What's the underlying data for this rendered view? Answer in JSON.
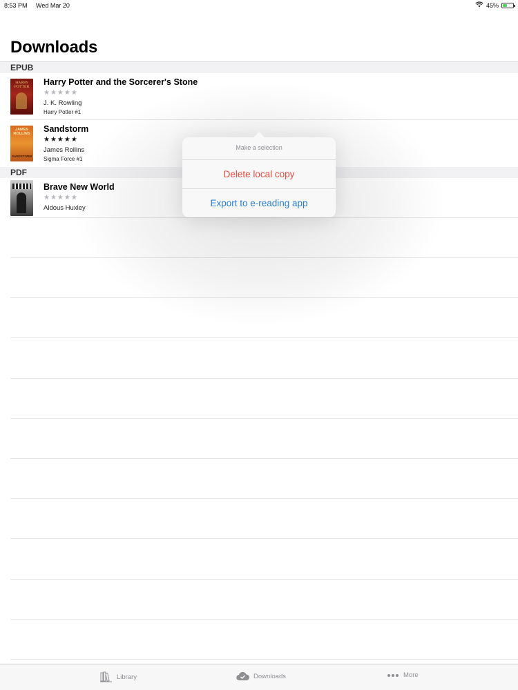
{
  "status_bar": {
    "time": "8:53 PM",
    "date": "Wed Mar 20",
    "battery": "45%",
    "battery_level": 0.45
  },
  "page": {
    "title": "Downloads"
  },
  "sections": [
    {
      "label": "EPUB",
      "items": [
        {
          "title": "Harry Potter and the Sorcerer's Stone",
          "stars": "★★★★★",
          "rated": false,
          "author": "J. K. Rowling",
          "series": "Harry Potter #1",
          "cover_text": "HARRY POTTER"
        },
        {
          "title": "Sandstorm",
          "stars": "★★★★★",
          "rated": true,
          "author": "James Rollins",
          "series": "Sigma Force #1",
          "cover_text": "JAMES ROLLINS",
          "cover_text2": "SANDSTORM"
        }
      ]
    },
    {
      "label": "PDF",
      "items": [
        {
          "title": "Brave New World",
          "stars": "★★★★★",
          "rated": false,
          "author": "Aldous Huxley"
        }
      ]
    }
  ],
  "popover": {
    "message": "Make a selection",
    "options": [
      "Delete local copy",
      "Export to e-reading app"
    ]
  },
  "tabs": [
    {
      "label": "Library",
      "icon": "books-icon"
    },
    {
      "label": "Downloads",
      "icon": "cloud-download-icon"
    },
    {
      "label": "More",
      "icon": "more-dots-icon"
    }
  ],
  "colors": {
    "destructive": "#e8473d",
    "action": "#2a7dd2",
    "inactive_tab": "#8e8e93"
  }
}
